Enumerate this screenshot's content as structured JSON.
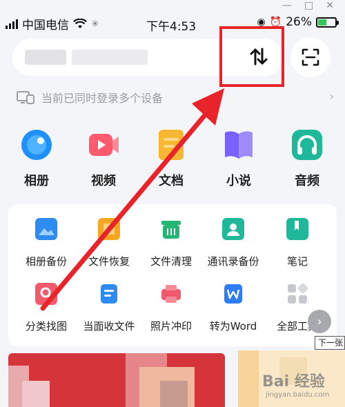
{
  "status_bar": {
    "carrier": "中国电信",
    "time": "下午4:53",
    "battery": "26%"
  },
  "device_notice": {
    "label": "当前已同时登录多个设备",
    "chevron": "›"
  },
  "categories": [
    {
      "label": "相册",
      "icon": "photo-album-icon",
      "color": "#1e90ff"
    },
    {
      "label": "视频",
      "icon": "video-icon",
      "color": "#ff5a6e"
    },
    {
      "label": "文档",
      "icon": "document-icon",
      "color": "#f7b733"
    },
    {
      "label": "小说",
      "icon": "novel-book-icon",
      "color": "#7b61ff"
    },
    {
      "label": "音频",
      "icon": "headphones-icon",
      "color": "#1fb99a"
    }
  ],
  "tools": [
    {
      "label": "相册备份",
      "icon": "photo-backup-icon",
      "color": "#2e8cf0"
    },
    {
      "label": "文件恢复",
      "icon": "file-restore-icon",
      "color": "#f6a623"
    },
    {
      "label": "文件清理",
      "icon": "file-cleanup-icon",
      "color": "#22b573"
    },
    {
      "label": "通讯录备份",
      "icon": "contacts-backup-icon",
      "color": "#1fb99a"
    },
    {
      "label": "笔记",
      "icon": "notes-icon",
      "color": "#1fb99a"
    },
    {
      "label": "分类找图",
      "icon": "image-search-icon",
      "color": "#f05a6c"
    },
    {
      "label": "当面收文件",
      "icon": "receive-file-icon",
      "color": "#2e8cf0"
    },
    {
      "label": "照片冲印",
      "icon": "photo-print-icon",
      "color": "#f05a6c"
    },
    {
      "label": "转为Word",
      "icon": "word-convert-icon",
      "color": "#2e7cf6"
    },
    {
      "label": "全部工具",
      "icon": "all-tools-grid-icon",
      "color": "#c6c8cd"
    }
  ],
  "tooltip": {
    "label": "下一张"
  },
  "watermark": {
    "logo": "Bai 经验",
    "url": "jingyan.baidu.com"
  },
  "colors": {
    "highlight_border": "#e8232a",
    "arrow": "#e8232a",
    "page_bg": "#f4f5f8"
  }
}
